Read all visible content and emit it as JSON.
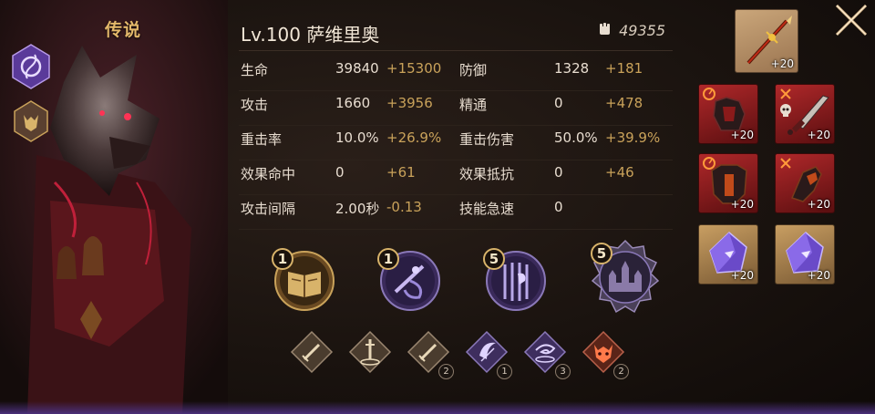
{
  "hero": {
    "rarity": "传说",
    "name": "Lv.100  萨维里奥",
    "power": "49355"
  },
  "stats": [
    {
      "left": {
        "label": "生命",
        "base": "39840",
        "bonus": "+15300"
      },
      "right": {
        "label": "防御",
        "base": "1328",
        "bonus": "+181"
      }
    },
    {
      "left": {
        "label": "攻击",
        "base": "1660",
        "bonus": "+3956"
      },
      "right": {
        "label": "精通",
        "base": "0",
        "bonus": "+478"
      }
    },
    {
      "left": {
        "label": "重击率",
        "base": "10.0%",
        "bonus": "+26.9%"
      },
      "right": {
        "label": "重击伤害",
        "base": "50.0%",
        "bonus": "+39.9%"
      }
    },
    {
      "left": {
        "label": "效果命中",
        "base": "0",
        "bonus": "+61"
      },
      "right": {
        "label": "效果抵抗",
        "base": "0",
        "bonus": "+46"
      }
    },
    {
      "left": {
        "label": "攻击间隔",
        "base": "2.00秒",
        "bonus": "-0.13"
      },
      "right": {
        "label": "技能急速",
        "base": "0",
        "bonus": ""
      }
    }
  ],
  "skills": [
    {
      "level": "1",
      "icon": "book-icon"
    },
    {
      "level": "1",
      "icon": "swirl-weapon-icon"
    },
    {
      "level": "5",
      "icon": "cage-icon"
    },
    {
      "level": "5",
      "icon": "castle-icon"
    }
  ],
  "runes": [
    {
      "icon": "sword-icon",
      "count": ""
    },
    {
      "icon": "sword-pedestal-icon",
      "count": ""
    },
    {
      "icon": "sword-icon",
      "count": "2"
    },
    {
      "icon": "crescent-icon",
      "count": "1"
    },
    {
      "icon": "vortex-icon",
      "count": "3"
    },
    {
      "icon": "demon-mask-icon",
      "count": "2"
    }
  ],
  "equipment": {
    "weapon": {
      "plus": "+20",
      "icon": "spear-icon"
    },
    "slots": [
      {
        "plus": "+20",
        "icon": "armor-icon"
      },
      {
        "plus": "+20",
        "icon": "dagger-icon"
      },
      {
        "plus": "+20",
        "icon": "chestplate-icon"
      },
      {
        "plus": "+20",
        "icon": "gauntlet-icon"
      },
      {
        "plus": "+20",
        "icon": "crystal-icon"
      },
      {
        "plus": "+20",
        "icon": "crystal-icon"
      }
    ]
  },
  "colors": {
    "gold_text": "#c9a25a",
    "rarity": "#e3b86a",
    "purple_accent": "#7a5ab8",
    "red_slot": "#b0282a"
  }
}
